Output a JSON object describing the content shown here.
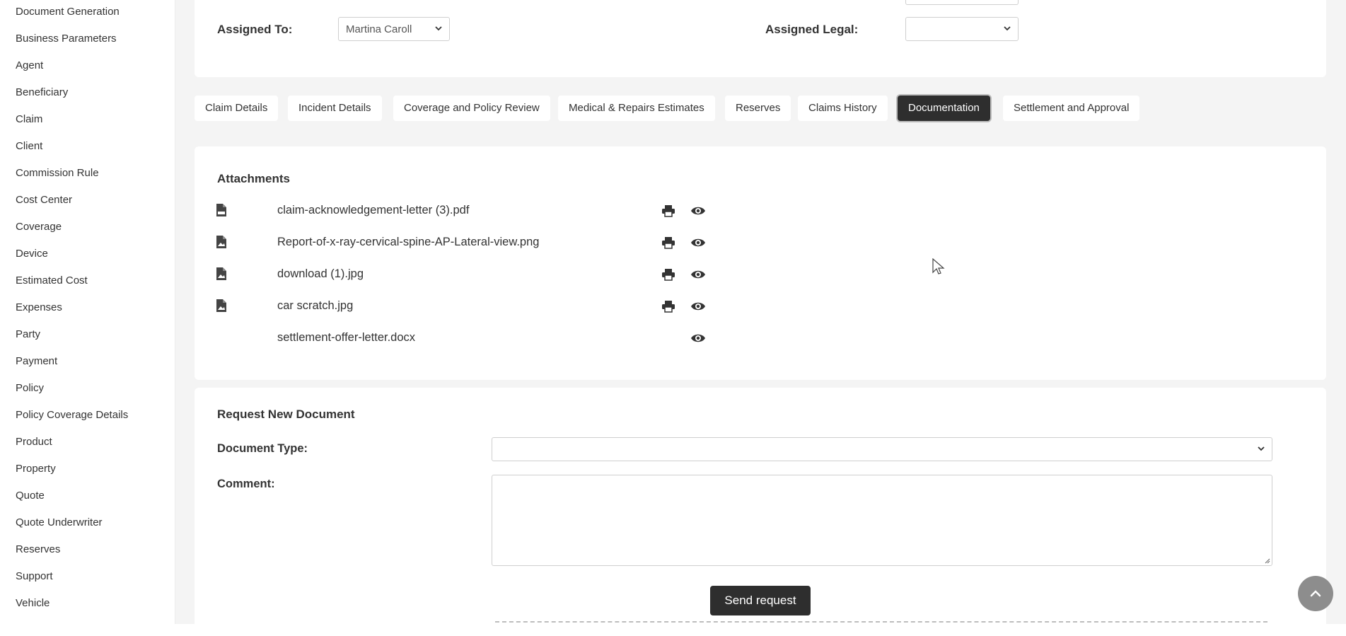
{
  "sidebar": {
    "items": [
      {
        "label": "Document Generation"
      },
      {
        "label": "Business Parameters"
      },
      {
        "label": "Agent"
      },
      {
        "label": "Beneficiary"
      },
      {
        "label": "Claim"
      },
      {
        "label": "Client"
      },
      {
        "label": "Commission Rule"
      },
      {
        "label": "Cost Center"
      },
      {
        "label": "Coverage"
      },
      {
        "label": "Device"
      },
      {
        "label": "Estimated Cost"
      },
      {
        "label": "Expenses"
      },
      {
        "label": "Party"
      },
      {
        "label": "Payment"
      },
      {
        "label": "Policy"
      },
      {
        "label": "Policy Coverage Details"
      },
      {
        "label": "Product"
      },
      {
        "label": "Property"
      },
      {
        "label": "Quote"
      },
      {
        "label": "Quote Underwriter"
      },
      {
        "label": "Reserves"
      },
      {
        "label": "Support"
      },
      {
        "label": "Vehicle"
      }
    ]
  },
  "assignment": {
    "assigned_to_label": "Assigned To:",
    "assigned_to_value": "Martina Caroll",
    "assigned_legal_label": "Assigned Legal:",
    "assigned_legal_value": ""
  },
  "tabs": [
    {
      "label": "Claim Details",
      "active": false
    },
    {
      "label": "Incident Details",
      "active": false
    },
    {
      "label": "Coverage and Policy Review",
      "active": false
    },
    {
      "label": "Medical & Repairs Estimates",
      "active": false
    },
    {
      "label": "Reserves",
      "active": false
    },
    {
      "label": "Claims History",
      "active": false
    },
    {
      "label": "Documentation",
      "active": true
    },
    {
      "label": "Settlement and Approval",
      "active": false
    }
  ],
  "attachments": {
    "title": "Attachments",
    "files": [
      {
        "name": "claim-acknowledgement-letter (3).pdf",
        "icon": "pdf-file-icon",
        "printable": true
      },
      {
        "name": "Report-of-x-ray-cervical-spine-AP-Lateral-view.png",
        "icon": "image-file-icon",
        "printable": true
      },
      {
        "name": "download (1).jpg",
        "icon": "image-file-icon",
        "printable": true
      },
      {
        "name": "car scratch.jpg",
        "icon": "image-file-icon",
        "printable": true
      },
      {
        "name": "settlement-offer-letter.docx",
        "icon": "",
        "printable": false
      }
    ]
  },
  "request": {
    "title": "Request New Document",
    "document_type_label": "Document Type:",
    "document_type_value": "",
    "comment_label": "Comment:",
    "comment_value": "",
    "send_label": "Send request"
  },
  "colors": {
    "active_tab": "#2e2e2e",
    "send_button": "#2e2e2e",
    "scroll_top_button": "#8d8d8d",
    "page_background": "#f4f4f4"
  }
}
